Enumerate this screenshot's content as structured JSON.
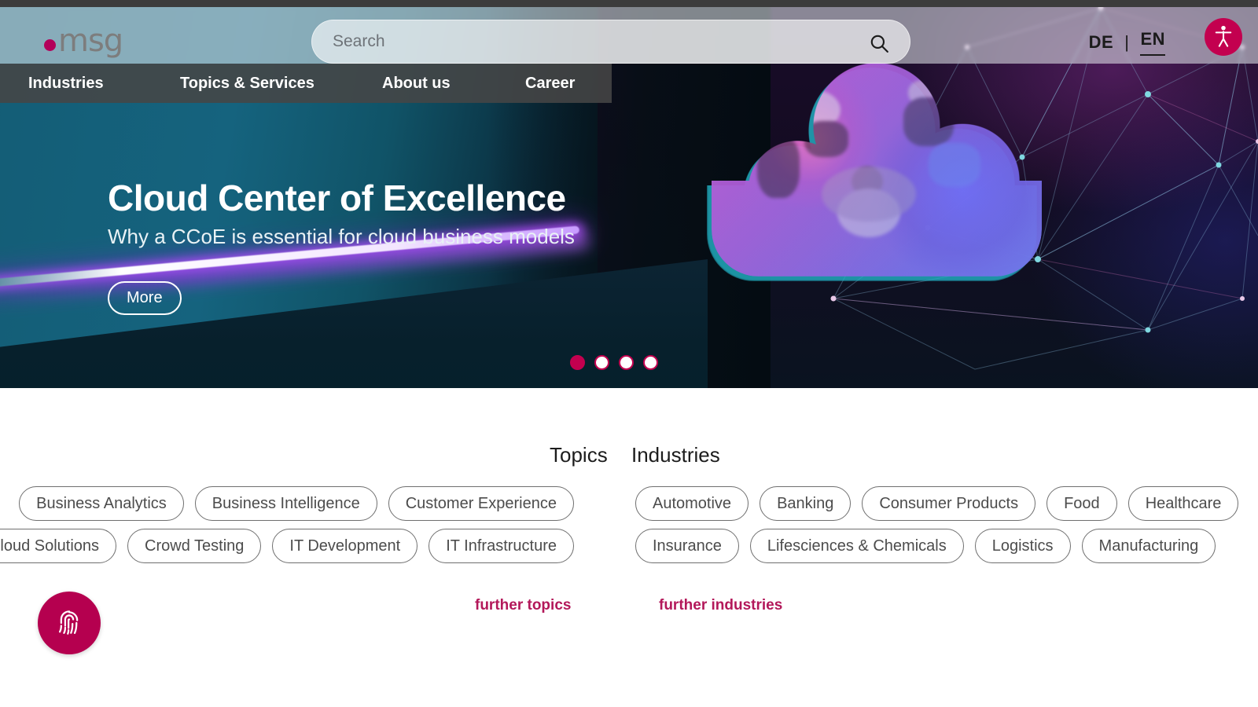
{
  "brand": {
    "logo_text": "msg",
    "accent_color": "#c3004f",
    "logo_gray": "#7d7d7d"
  },
  "header": {
    "search": {
      "placeholder": "Search",
      "value": "",
      "icon": "search-icon"
    },
    "languages": [
      {
        "code": "DE",
        "active": false
      },
      {
        "code": "EN",
        "active": true
      }
    ],
    "language_separator": "|",
    "accessibility_button": {
      "icon": "accessibility-person-icon",
      "label": "Accessibility"
    }
  },
  "nav": {
    "items": [
      {
        "label": "Industries"
      },
      {
        "label": "Topics & Services"
      },
      {
        "label": "About us"
      },
      {
        "label": "Career"
      }
    ]
  },
  "hero": {
    "title": "Cloud Center of Excellence",
    "subtitle": "Why a CCoE is essential for cloud business models",
    "button_label": "More",
    "carousel": {
      "total": 4,
      "active_index": 0
    },
    "image_alt": "cloud-shaped photo of people meeting"
  },
  "main": {
    "columns": [
      {
        "heading": "Topics",
        "rows": [
          [
            "Business Analytics",
            "Business Intelligence",
            "Customer Experience"
          ],
          [
            "Cloud Solutions",
            "Crowd Testing",
            "IT Development",
            "IT Infrastructure"
          ]
        ],
        "further_label": "further topics"
      },
      {
        "heading": "Industries",
        "rows": [
          [
            "Automotive",
            "Banking",
            "Consumer Products",
            "Food",
            "Healthcare"
          ],
          [
            "Insurance",
            "Lifesciences & Chemicals",
            "Logistics",
            "Manufacturing"
          ]
        ],
        "further_label": "further industries"
      }
    ]
  },
  "privacy_fab": {
    "icon": "fingerprint-icon",
    "label": "Privacy settings"
  }
}
